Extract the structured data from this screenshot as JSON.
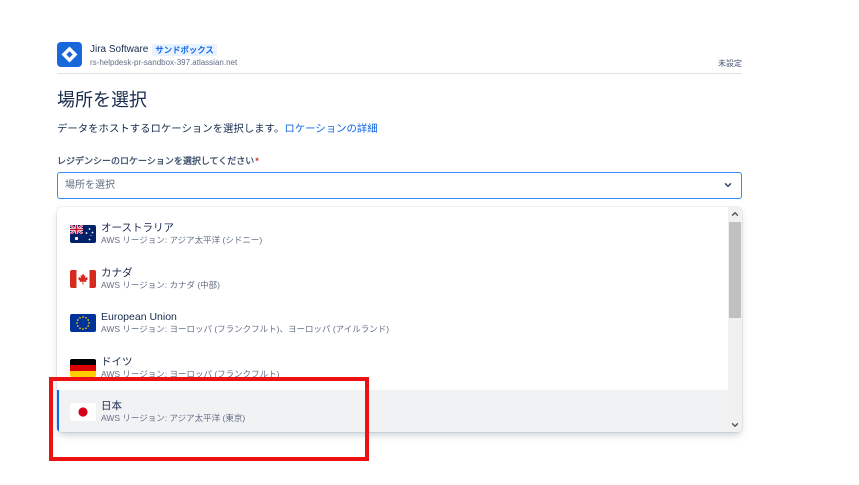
{
  "header": {
    "app_name": "Jira Software",
    "badge": "サンドボックス",
    "site_url": "rs-helpdesk-pr-sandbox-397.atlassian.net",
    "status": "未設定",
    "logo_icon": "jira-logo-icon"
  },
  "page": {
    "title": "場所を選択",
    "description": "データをホストするロケーションを選択します。",
    "details_link": "ロケーションの詳細"
  },
  "field": {
    "label": "レジデンシーのロケーションを選択してください",
    "required_mark": "*",
    "placeholder": "場所を選択",
    "chevron_icon": "chevron-down-icon"
  },
  "options": [
    {
      "name": "オーストラリア",
      "region": "AWS リージョン: アジア太平洋 (シドニー)",
      "icon": "australia-flag-icon",
      "highlighted": false
    },
    {
      "name": "カナダ",
      "region": "AWS リージョン: カナダ (中部)",
      "icon": "canada-flag-icon",
      "highlighted": false
    },
    {
      "name": "European Union",
      "region": "AWS リージョン: ヨーロッパ (フランクフルト)、ヨーロッパ (アイルランド)",
      "icon": "european-union-flag-icon",
      "highlighted": false
    },
    {
      "name": "ドイツ",
      "region": "AWS リージョン: ヨーロッパ (フランクフルト)",
      "icon": "germany-flag-icon",
      "highlighted": false
    },
    {
      "name": "日本",
      "region": "AWS リージョン: アジア太平洋 (東京)",
      "icon": "japan-flag-icon",
      "highlighted": true
    }
  ],
  "colors": {
    "text": "#172b4d",
    "subtle_text": "#626f86",
    "brand": "#1868db",
    "link": "#0c66e4",
    "badge_bg": "#e9f2ff",
    "focus_border": "#388bff",
    "required": "#c9372c",
    "highlight_bg": "#f1f2f4",
    "annotation": "#ee1111"
  }
}
